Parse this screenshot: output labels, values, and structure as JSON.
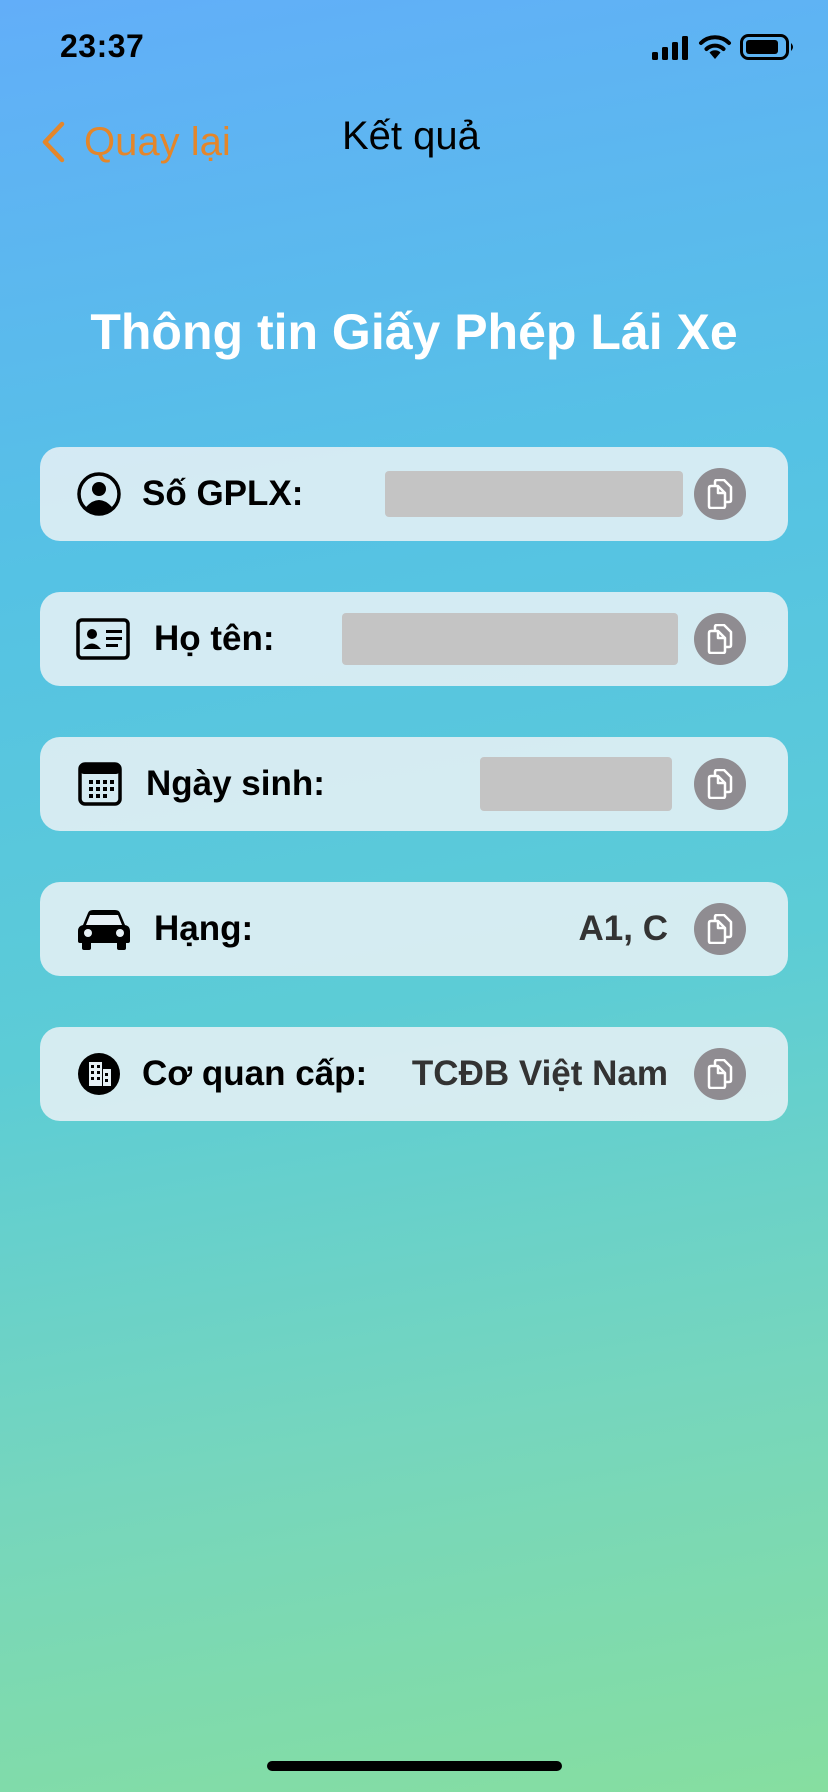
{
  "status_bar": {
    "time": "23:37",
    "icons": [
      "cellular-signal-icon",
      "wifi-icon",
      "battery-icon"
    ]
  },
  "nav": {
    "back_label": "Quay lại",
    "back_icon": "chevron-left-icon",
    "title": "Kết quả"
  },
  "heading": "Thông tin Giấy Phép Lái Xe",
  "fields": {
    "license_number": {
      "label": "Số GPLX:",
      "icon": "person-circle-icon",
      "value_redacted": true
    },
    "full_name": {
      "label": "Họ tên:",
      "icon": "id-card-icon",
      "value_redacted": true
    },
    "birth_date": {
      "label": "Ngày sinh:",
      "icon": "calendar-icon",
      "value_redacted": true
    },
    "license_class": {
      "label": "Hạng:",
      "icon": "car-icon",
      "value": "A1, C"
    },
    "issuer": {
      "label": "Cơ quan cấp:",
      "icon": "building-icon",
      "value": "TCĐB Việt Nam"
    }
  },
  "copy_icon": "copy-icon",
  "colors": {
    "accent": "#e4862a",
    "card_background": "#e6f0f5",
    "copy_button": "#8f8c91",
    "redaction": "#c4c4c4",
    "gradient_top": "#62aef9",
    "gradient_bottom": "#86dea0"
  }
}
